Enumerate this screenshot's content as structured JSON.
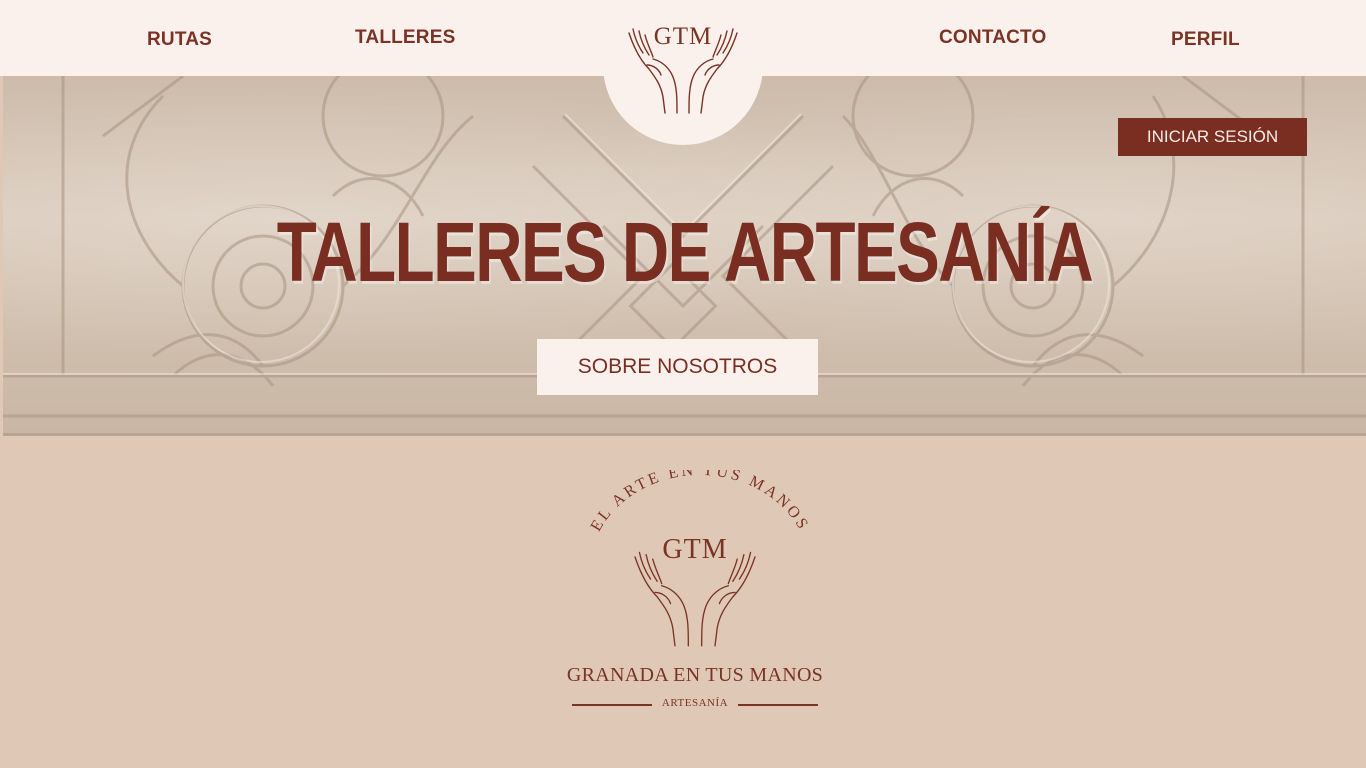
{
  "nav": {
    "items": [
      {
        "label": "RUTAS"
      },
      {
        "label": "TALLERES"
      },
      {
        "label": "CONTACTO"
      },
      {
        "label": "PERFIL"
      }
    ],
    "logo_text": "GTM"
  },
  "hero": {
    "title": "TALLERES DE ARTESANÍA",
    "login_label": "INICIAR SESIÓN",
    "about_label": "SOBRE NOSOTROS"
  },
  "emblem": {
    "arc_text": "EL ARTE EN TUS MANOS",
    "logo_text": "GTM",
    "company": "GRANADA EN TUS MANOS",
    "subtitle": "ARTESANÍA"
  },
  "colors": {
    "accent": "#7a2e22",
    "nav_bg": "#fbf1ec",
    "page_bg": "#e0c8b6"
  }
}
